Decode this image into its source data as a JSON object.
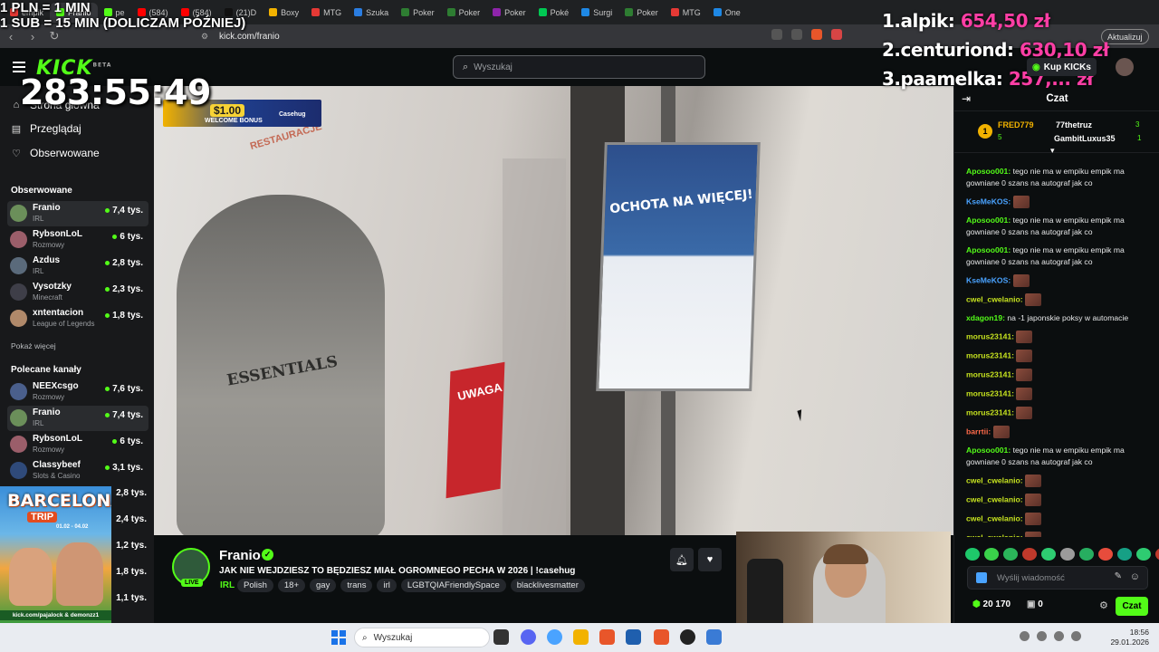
{
  "browser": {
    "tabs": [
      "empik",
      "Franio",
      "pe",
      "(584)",
      "(584)",
      "(21)D",
      "Boxy",
      "MTG",
      "Szuka",
      "Poker",
      "Poker",
      "Poker",
      "Poké",
      "Surgi",
      "Poker",
      "MTG",
      "One"
    ],
    "url": "kick.com/franio",
    "update_label": "Aktualizuj"
  },
  "overlay": {
    "line1": "1 PLN = 1 MIN",
    "line2": "1 SUB = 15 MIN (DOLICZAM PÓŹNIEJ)",
    "timer": "283:55:49",
    "ranking": [
      {
        "name": "1.alpik:",
        "amount": "654,50 zł"
      },
      {
        "name": "2.centuriond:",
        "amount": "630,10 zł"
      },
      {
        "name": "3.paamelka:",
        "amount": "257,... zł"
      }
    ]
  },
  "kick": {
    "logo": "KICK",
    "logo_tag": "BETA",
    "search_placeholder": "Wyszukaj",
    "kicks_label": "Kup KICKs"
  },
  "sidebar": {
    "nav": [
      {
        "label": "Strona główna",
        "icon": "home-icon"
      },
      {
        "label": "Przeglądaj",
        "icon": "browse-icon"
      },
      {
        "label": "Obserwowane",
        "icon": "heart-icon"
      }
    ],
    "following_title": "Obserwowane",
    "following": [
      {
        "name": "Franio",
        "category": "IRL",
        "viewers": "7,4 tys.",
        "color": "#6b8f5a"
      },
      {
        "name": "RybsonLoL",
        "category": "Rozmowy",
        "viewers": "6 tys.",
        "color": "#9b5e6a"
      },
      {
        "name": "Azdus",
        "category": "IRL",
        "viewers": "2,8 tys.",
        "color": "#5a6a7b"
      },
      {
        "name": "Vysotzky",
        "category": "Minecraft",
        "viewers": "2,3 tys.",
        "color": "#3e3e48"
      },
      {
        "name": "xntentacion",
        "category": "League of Legends",
        "viewers": "1,8 tys.",
        "color": "#b0896a"
      }
    ],
    "show_more": "Pokaż więcej",
    "recommended_title": "Polecane kanały",
    "recommended": [
      {
        "name": "NEEXcsgo",
        "category": "Rozmowy",
        "viewers": "7,6 tys.",
        "color": "#4a5f8c"
      },
      {
        "name": "Franio",
        "category": "IRL",
        "viewers": "7,4 tys.",
        "color": "#6b8f5a"
      },
      {
        "name": "RybsonLoL",
        "category": "Rozmowy",
        "viewers": "6 tys.",
        "color": "#9b5e6a"
      },
      {
        "name": "Classybeef",
        "category": "Slots & Casino",
        "viewers": "3,1 tys.",
        "color": "#2f4a7a"
      }
    ],
    "extra_viewers": [
      "2,8 tys.",
      "2,4 tys.",
      "1,2 tys.",
      "1,8 tys.",
      "1,1 tys."
    ]
  },
  "video": {
    "promo_amount": "$1.00",
    "promo_text": "WELCOME BONUS",
    "promo_brand": "Casehug",
    "scene_text_hoodie": "ESSENTIALS",
    "scene_text_poster": "OCHOTA NA WIĘCEJ!",
    "scene_text_warning": "UWAGA",
    "scene_text_wall": "RESTAURACJE"
  },
  "stream": {
    "name": "Franio",
    "live": "LIVE",
    "title": "JAK NIE WEJDZIESZ TO BĘDZIESZ MIAŁ OGROMNEGO PECHA W 2026 | !casehug",
    "category": "IRL",
    "tags": [
      "Polish",
      "18+",
      "gay",
      "trans",
      "irl",
      "LGBTQIAFriendlySpace",
      "blacklivesmatter"
    ]
  },
  "chat": {
    "title": "Czat",
    "leaderboard": [
      {
        "rank": "1",
        "name": "FRED779",
        "count": "5"
      },
      {
        "name": "77thetruz",
        "count": "3"
      },
      {
        "name": "GambitLuxus35",
        "count": "1"
      }
    ],
    "messages": [
      {
        "user": "Aposoo001:",
        "text": "tego nie ma w empiku empik ma gowniane 0 szans na autograf jak co",
        "color": "#53fc18"
      },
      {
        "user": "KseMeKOS:",
        "text": "",
        "emote": true,
        "color": "#4aa3ff"
      },
      {
        "user": "Aposoo001:",
        "text": "tego nie ma w empiku empik ma gowniane 0 szans na autograf jak co",
        "color": "#53fc18"
      },
      {
        "user": "Aposoo001:",
        "text": "tego nie ma w empiku empik ma gowniane 0 szans na autograf jak co",
        "color": "#53fc18"
      },
      {
        "user": "KseMeKOS:",
        "text": "",
        "emote": true,
        "color": "#4aa3ff"
      },
      {
        "user": "cwel_cwelanio:",
        "text": "",
        "emote": true,
        "color": "#c6e21f"
      },
      {
        "user": "xdagon19:",
        "text": "na -1 japonskie poksy w automacie",
        "color": "#53fc18"
      },
      {
        "user": "morus23141:",
        "text": "",
        "emote": true,
        "color": "#c6e21f"
      },
      {
        "user": "morus23141:",
        "text": "",
        "emote": true,
        "color": "#c6e21f"
      },
      {
        "user": "morus23141:",
        "text": "",
        "emote": true,
        "color": "#c6e21f"
      },
      {
        "user": "morus23141:",
        "text": "",
        "emote": true,
        "color": "#c6e21f"
      },
      {
        "user": "morus23141:",
        "text": "",
        "emote": true,
        "color": "#c6e21f"
      },
      {
        "user": "barrtii:",
        "text": "",
        "emote": true,
        "color": "#ff6a4a"
      },
      {
        "user": "Aposoo001:",
        "text": "tego nie ma w empiku empik ma gowniane 0 szans na autograf jak co",
        "color": "#53fc18"
      },
      {
        "user": "cwel_cwelanio:",
        "text": "",
        "emote": true,
        "color": "#c6e21f"
      },
      {
        "user": "cwel_cwelanio:",
        "text": "",
        "emote": true,
        "color": "#c6e21f"
      },
      {
        "user": "cwel_cwelanio:",
        "text": "",
        "emote": true,
        "color": "#c6e21f"
      },
      {
        "user": "cwel_cwelanio:",
        "text": "",
        "emote": true,
        "color": "#c6e21f"
      }
    ],
    "input_placeholder": "Wyślij wiadomość",
    "points": "20 170",
    "gifts": "0",
    "send_label": "Czat"
  },
  "barcelona": {
    "title": "BARCELONA",
    "trip": "TRIP",
    "dates": "01.02 - 04.02",
    "footer": "kick.com/pajalock & demonzz1"
  },
  "taskbar": {
    "search_placeholder": "Wyszukaj",
    "time": "18:56",
    "date": "29.01.2026"
  }
}
